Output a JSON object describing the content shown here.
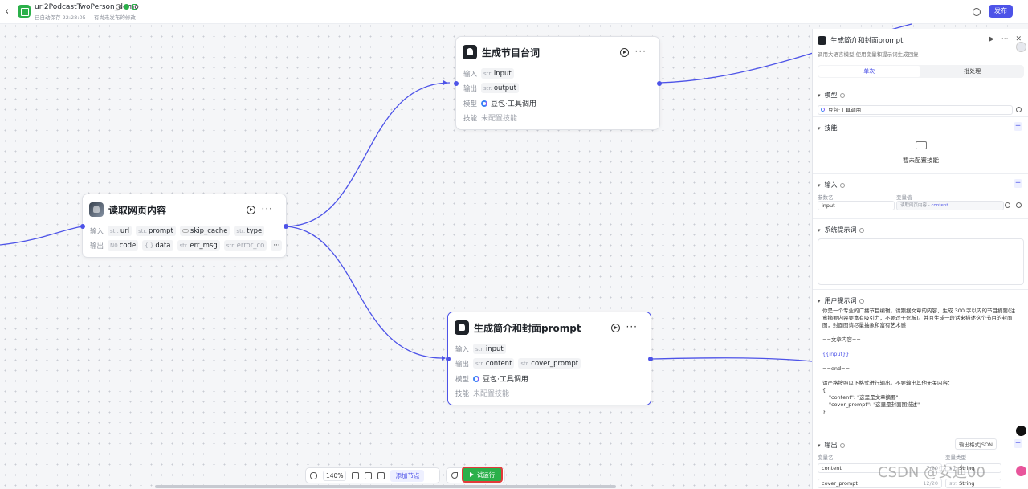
{
  "header": {
    "app_title": "url2PodcastTwoPerson_demo",
    "saved_status": "已自动保存 22:28:05",
    "unpublished_status": "有尚未发布的修改",
    "publish_label": "发布"
  },
  "nodes": {
    "read": {
      "title": "读取网页内容",
      "input_label": "输入",
      "output_label": "输出",
      "inputs": [
        {
          "type": "str.",
          "name": "url"
        },
        {
          "type": "str.",
          "name": "prompt"
        },
        {
          "type": "",
          "name": "skip_cache"
        },
        {
          "type": "str.",
          "name": "type"
        }
      ],
      "outputs": [
        {
          "type": "N0",
          "name": "code"
        },
        {
          "type": "{ }",
          "name": "data"
        },
        {
          "type": "str.",
          "name": "err_msg"
        },
        {
          "type": "str.",
          "name": "error_co"
        }
      ]
    },
    "script": {
      "title": "生成节目台词",
      "input_label": "输入",
      "output_label": "输出",
      "model_label": "模型",
      "skill_label": "技能",
      "input": {
        "type": "str.",
        "name": "input"
      },
      "output": {
        "type": "str.",
        "name": "output"
      },
      "model": "豆包·工具调用",
      "skill": "未配置技能"
    },
    "intro": {
      "title": "生成简介和封面prompt",
      "input_label": "输入",
      "output_label": "输出",
      "model_label": "模型",
      "skill_label": "技能",
      "input": {
        "type": "str.",
        "name": "input"
      },
      "outputs": [
        {
          "type": "str.",
          "name": "content"
        },
        {
          "type": "str.",
          "name": "cover_prompt"
        }
      ],
      "model": "豆包·工具调用",
      "skill": "未配置技能"
    }
  },
  "toolbar": {
    "zoom": "140%",
    "add_node": "添加节点",
    "run": "试运行"
  },
  "panel": {
    "title": "生成简介和封面prompt",
    "description": "调用大语言模型,使用变量和提示词生成回复",
    "tabs": [
      "单次",
      "批处理"
    ],
    "model_section": "模型",
    "model_value": "豆包·工具调用",
    "skill_section": "技能",
    "skill_empty": "暂未配置技能",
    "input_section": "输入",
    "param_name_header": "参数名",
    "param_value_header": "变量值",
    "input_name": "input",
    "input_ref_prefix": "读取网页内容 - ",
    "input_ref_field": "content",
    "system_prompt_section": "系统提示词",
    "user_prompt_section": "用户提示词",
    "user_prompt_lines": [
      "你是一个专业的广播节目编辑。请跟据文章的内容，生成 300 字以内的节目摘要(注意摘要内容要富有吸引力，不要过于死板)。并且生成一段话来描述这个节目的封面图，封面图请尽量抽象和富有艺术感",
      "",
      "==文章内容==",
      "",
      "{{input}}",
      "",
      "==end==",
      "",
      "请严格按照以下格式进行输出。不要输出其他无关内容：",
      "{",
      "\"content\": \"这里是文章摘要\",",
      "\"cover_prompt\": \"这里是封面图描述\"",
      "}"
    ],
    "output_section": "输出",
    "output_format": "输出格式JSON",
    "var_name_header": "变量名",
    "var_type_header": "变量类型",
    "outputs": [
      {
        "name": "content",
        "count": "7/20",
        "type": "String"
      },
      {
        "name": "cover_prompt",
        "count": "12/20",
        "type": "String"
      }
    ]
  },
  "watermark": "CSDN @安迪00"
}
